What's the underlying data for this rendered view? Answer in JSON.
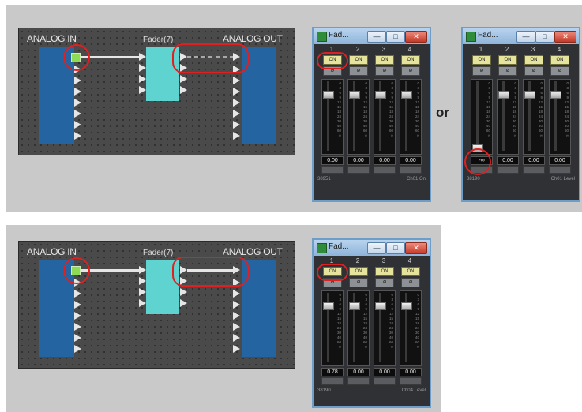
{
  "diagram_labels": {
    "analog_in": "ANALOG IN",
    "fader": "Fader(7)",
    "analog_out": "ANALOG OUT",
    "or": "or"
  },
  "window": {
    "title": "Fad...",
    "minimize_glyph": "—",
    "restore_glyph": "□",
    "close_glyph": "✕",
    "channels": [
      "1",
      "2",
      "3",
      "4"
    ],
    "on_label": "ON",
    "phase_glyph": "ø",
    "scale_ticks": [
      "0",
      "3",
      "6",
      "9",
      "12",
      "15",
      "18",
      "24",
      "30",
      "40",
      "60",
      "∞"
    ]
  },
  "windows": [
    {
      "levels": [
        "0.00",
        "0.00",
        "0.00",
        "0.00"
      ],
      "status_left": "38951",
      "status_right": "Ch01 On"
    },
    {
      "levels": [
        "-∞",
        "0.00",
        "0.00",
        "0.00"
      ],
      "status_left": "38190",
      "status_right": "Ch01 Level"
    },
    {
      "levels": [
        "0.78",
        "0.00",
        "0.00",
        "0.00"
      ],
      "status_left": "38190",
      "status_right": "Ch04 Level"
    }
  ]
}
